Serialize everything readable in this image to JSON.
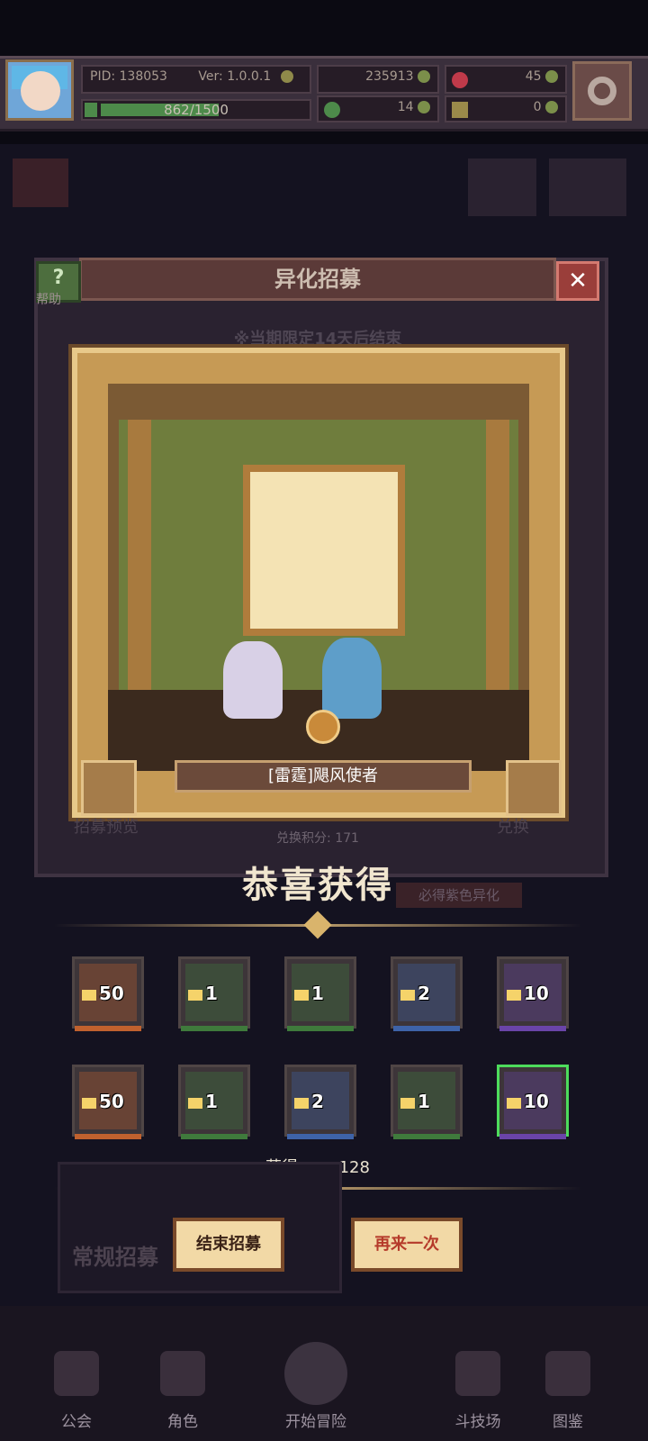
{
  "player": {
    "pid": "PID: 138053",
    "version": "Ver: 1.0.0.1",
    "xp": "862/1500",
    "xp_fraction": 0.575
  },
  "currencies": {
    "gold": "235913",
    "gems": "45",
    "clover": "14",
    "key": "0"
  },
  "modal": {
    "title": "异化招募",
    "help_label": "帮助",
    "limited_notice": "※当期限定14天后结束"
  },
  "reward": {
    "character_name": "[雷霆]飓风使者",
    "exchange_points": "兑换积分: 171",
    "congrats": "恭喜获得"
  },
  "background_ui": {
    "preview_label": "招募预览",
    "exchange_label": "兑换",
    "guarantee_label": "必得紫色异化",
    "regular_recruit": "常规招募"
  },
  "items": [
    {
      "count": "50",
      "tier": "orange"
    },
    {
      "count": "1",
      "tier": "green"
    },
    {
      "count": "1",
      "tier": "green"
    },
    {
      "count": "2",
      "tier": "blue"
    },
    {
      "count": "10",
      "tier": "purple"
    },
    {
      "count": "50",
      "tier": "orange"
    },
    {
      "count": "1",
      "tier": "green"
    },
    {
      "count": "2",
      "tier": "blue"
    },
    {
      "count": "1",
      "tier": "green"
    },
    {
      "count": "10",
      "tier": "purple"
    }
  ],
  "obtained": {
    "prefix": "获得",
    "suffix": "×128"
  },
  "buttons": {
    "end_recruit": "结束招募",
    "again": "再来一次"
  },
  "nav": [
    {
      "label": "公会",
      "icon": "guild-icon"
    },
    {
      "label": "角色",
      "icon": "character-icon"
    },
    {
      "label": "开始冒险",
      "icon": "adventure-icon"
    },
    {
      "label": "斗技场",
      "icon": "arena-icon"
    },
    {
      "label": "图鉴",
      "icon": "codex-icon"
    }
  ],
  "colors": {
    "orange": "#c0612e",
    "green": "#3f7a3c",
    "blue": "#3e63a8",
    "purple": "#6a44a8",
    "selected": "#4ddc5c",
    "again_text": "#b53a2a"
  }
}
